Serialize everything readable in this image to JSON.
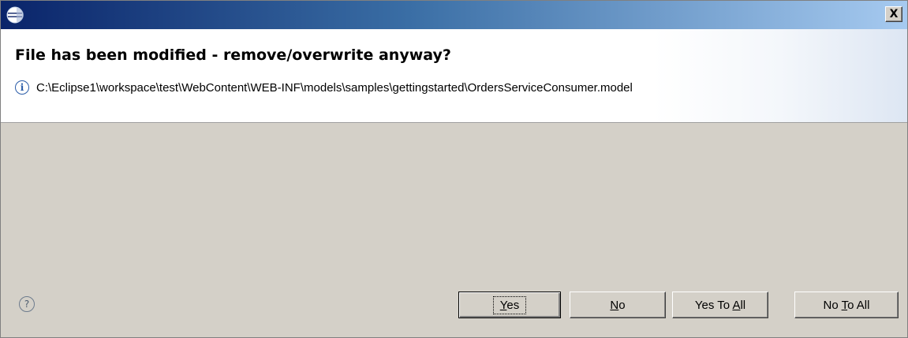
{
  "window": {
    "title_icon": "eclipse-icon",
    "close_label": "X"
  },
  "header": {
    "heading": "File has been modified - remove/overwrite anyway?",
    "info_icon": "info-icon",
    "message": "C:\\Eclipse1\\workspace\\test\\WebContent\\WEB-INF\\models\\samples\\gettingstarted\\OrdersServiceConsumer.model"
  },
  "footer": {
    "help_icon": "help-icon",
    "help_glyph": "?",
    "buttons": {
      "yes": {
        "pre": "",
        "mnemonic": "Y",
        "post": "es"
      },
      "no": {
        "pre": "",
        "mnemonic": "N",
        "post": "o"
      },
      "yes_to_all": {
        "pre": "Yes To ",
        "mnemonic": "A",
        "post": "ll"
      },
      "no_to_all": {
        "pre": "No ",
        "mnemonic": "T",
        "post": "o All"
      }
    }
  },
  "colors": {
    "title_gradient_start": "#0a246a",
    "title_gradient_end": "#a6caf0",
    "dialog_background": "#d4d0c8",
    "header_background": "#ffffff",
    "info_icon": "#2a5ca8"
  }
}
